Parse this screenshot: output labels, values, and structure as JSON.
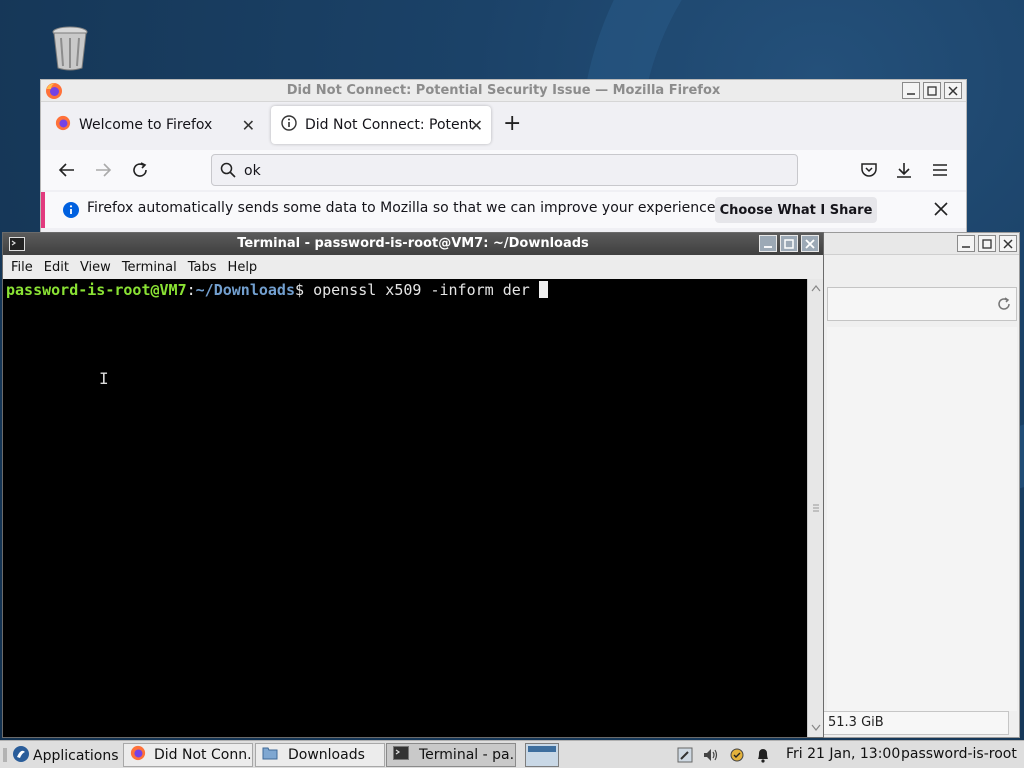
{
  "firefox": {
    "window_title": "Did Not Connect: Potential Security Issue — Mozilla Firefox",
    "tabs": [
      {
        "label": "Welcome to Firefox",
        "active": false
      },
      {
        "label": "Did Not Connect: Potenti",
        "active": true
      }
    ],
    "url_value": "ok",
    "notification": {
      "text": "Firefox automatically sends some data to Mozilla so that we can improve your experience.",
      "button": "Choose What I Share"
    }
  },
  "file_manager": {
    "status": "51.3 GiB"
  },
  "terminal": {
    "title": "Terminal - password-is-root@VM7: ~/Downloads",
    "menu": [
      "File",
      "Edit",
      "View",
      "Terminal",
      "Tabs",
      "Help"
    ],
    "prompt_user": "password-is-root@VM7",
    "prompt_sep": ":",
    "prompt_path": "~/Downloads",
    "prompt_symbol": "$ ",
    "command": "openssl x509 -inform der "
  },
  "taskbar": {
    "applications": "Applications",
    "tasks": [
      {
        "label": "Did Not Conn...",
        "icon": "firefox-icon"
      },
      {
        "label": "Downloads",
        "icon": "folder-icon"
      },
      {
        "label": "Terminal - pa...",
        "icon": "terminal-icon"
      }
    ],
    "clock": "Fri 21 Jan, 13:00",
    "user": "password-is-root"
  },
  "colors": {
    "terminal_bg": "#000000",
    "prompt_user": "#8ae234",
    "prompt_path": "#729fcf",
    "notification_accent": "#e23b7e"
  }
}
